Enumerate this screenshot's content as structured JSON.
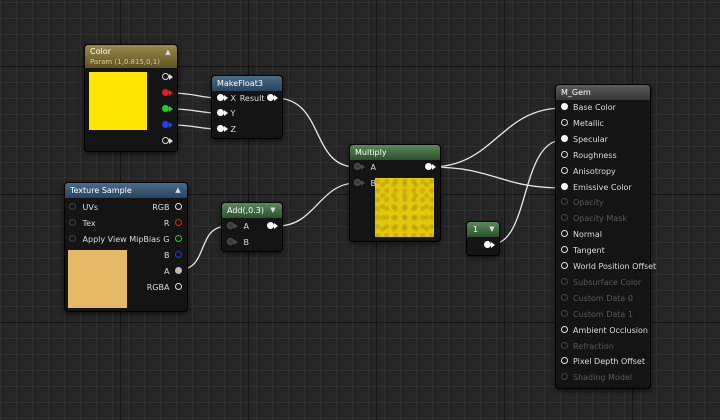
{
  "nodes": {
    "color": {
      "title": "Color",
      "subtitle": "Param (1,0.815,0,1)",
      "swatch": "#ffe600",
      "outputs": [
        {
          "name": "output-rgba",
          "color": "#ffffff"
        },
        {
          "name": "output-r",
          "color": "#e02020"
        },
        {
          "name": "output-g",
          "color": "#20d020"
        },
        {
          "name": "output-b",
          "color": "#2040f0"
        },
        {
          "name": "output-a",
          "color": "#ffffff"
        }
      ]
    },
    "makefloat3": {
      "title": "MakeFloat3",
      "inputs": [
        "X",
        "Y",
        "Z"
      ],
      "output": "Result"
    },
    "texture": {
      "title": "Texture Sample",
      "inputs": [
        "UVs",
        "Tex",
        "Apply View MipBias"
      ],
      "outputs": [
        "RGB",
        "R",
        "G",
        "B",
        "A",
        "RGBA"
      ],
      "swatch": "#e5b866"
    },
    "add": {
      "title": "Add(,0.3)",
      "inputs": [
        "A",
        "B"
      ]
    },
    "multiply": {
      "title": "Multiply",
      "inputs": [
        "A",
        "B"
      ],
      "swatch": "#e1c70e"
    },
    "constant": {
      "title": "1"
    },
    "material": {
      "title": "M_Gem",
      "inputs": [
        {
          "label": "Base Color",
          "enabled": true
        },
        {
          "label": "Metallic",
          "enabled": true
        },
        {
          "label": "Specular",
          "enabled": true
        },
        {
          "label": "Roughness",
          "enabled": true
        },
        {
          "label": "Anisotropy",
          "enabled": true
        },
        {
          "label": "Emissive Color",
          "enabled": true
        },
        {
          "label": "Opacity",
          "enabled": false
        },
        {
          "label": "Opacity Mask",
          "enabled": false
        },
        {
          "label": "Normal",
          "enabled": true
        },
        {
          "label": "Tangent",
          "enabled": true
        },
        {
          "label": "World Position Offset",
          "enabled": true
        },
        {
          "label": "Subsurface Color",
          "enabled": false
        },
        {
          "label": "Custom Data 0",
          "enabled": false
        },
        {
          "label": "Custom Data 1",
          "enabled": false
        },
        {
          "label": "Ambient Occlusion",
          "enabled": true
        },
        {
          "label": "Refraction",
          "enabled": false
        },
        {
          "label": "Pixel Depth Offset",
          "enabled": true
        },
        {
          "label": "Shading Model",
          "enabled": false
        }
      ]
    }
  }
}
